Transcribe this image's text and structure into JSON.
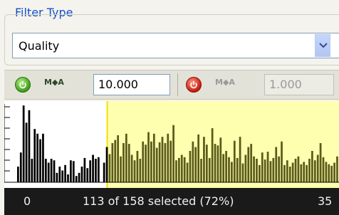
{
  "filter": {
    "group_label": "Filter Type",
    "selected_value": "Quality"
  },
  "toolbar": {
    "left": {
      "mga_label": "M⁠◆A",
      "value": "10.000",
      "enabled": true
    },
    "right": {
      "mga_label": "M⁠◆A",
      "value": "1.000",
      "enabled": false
    }
  },
  "colors": {
    "selection": "#ffffb0",
    "selection_edge": "#f0e000",
    "bars_selected": "#5a5a1a",
    "bars_unselected": "#000000",
    "status_bg": "#1a1a1a"
  },
  "histogram": {
    "selection_start_fraction": 0.28,
    "bar_heights": [
      0.2,
      0.38,
      0.98,
      0.76,
      0.92,
      0.3,
      0.68,
      0.62,
      0.55,
      0.62,
      0.3,
      0.25,
      0.3,
      0.28,
      0.12,
      0.2,
      0.15,
      0.22,
      0.1,
      0.28,
      0.27,
      0.08,
      0.12,
      0.2,
      0.31,
      0.18,
      0.28,
      0.35,
      0.3,
      0.32,
      0.0,
      0.25,
      0.45,
      0.36,
      0.5,
      0.54,
      0.6,
      0.33,
      0.5,
      0.62,
      0.49,
      0.35,
      0.28,
      0.4,
      0.3,
      0.52,
      0.48,
      0.64,
      0.52,
      0.62,
      0.44,
      0.51,
      0.58,
      0.5,
      0.62,
      0.53,
      0.73,
      0.28,
      0.31,
      0.35,
      0.32,
      0.25,
      0.4,
      0.52,
      0.45,
      0.61,
      0.3,
      0.58,
      0.48,
      0.31,
      0.69,
      0.49,
      0.47,
      0.57,
      0.36,
      0.4,
      0.32,
      0.26,
      0.53,
      0.31,
      0.58,
      0.24,
      0.35,
      0.45,
      0.49,
      0.33,
      0.3,
      0.22,
      0.38,
      0.29,
      0.39,
      0.27,
      0.31,
      0.45,
      0.33,
      0.52,
      0.22,
      0.28,
      0.2,
      0.25,
      0.3,
      0.33,
      0.23,
      0.26,
      0.22,
      0.3,
      0.4,
      0.28,
      0.35,
      0.5,
      0.32,
      0.26,
      0.23,
      0.21,
      0.25,
      0.33
    ]
  },
  "status": {
    "min_label": "0",
    "selection_text": "113 of 158 selected (72%)",
    "max_label": "35"
  }
}
